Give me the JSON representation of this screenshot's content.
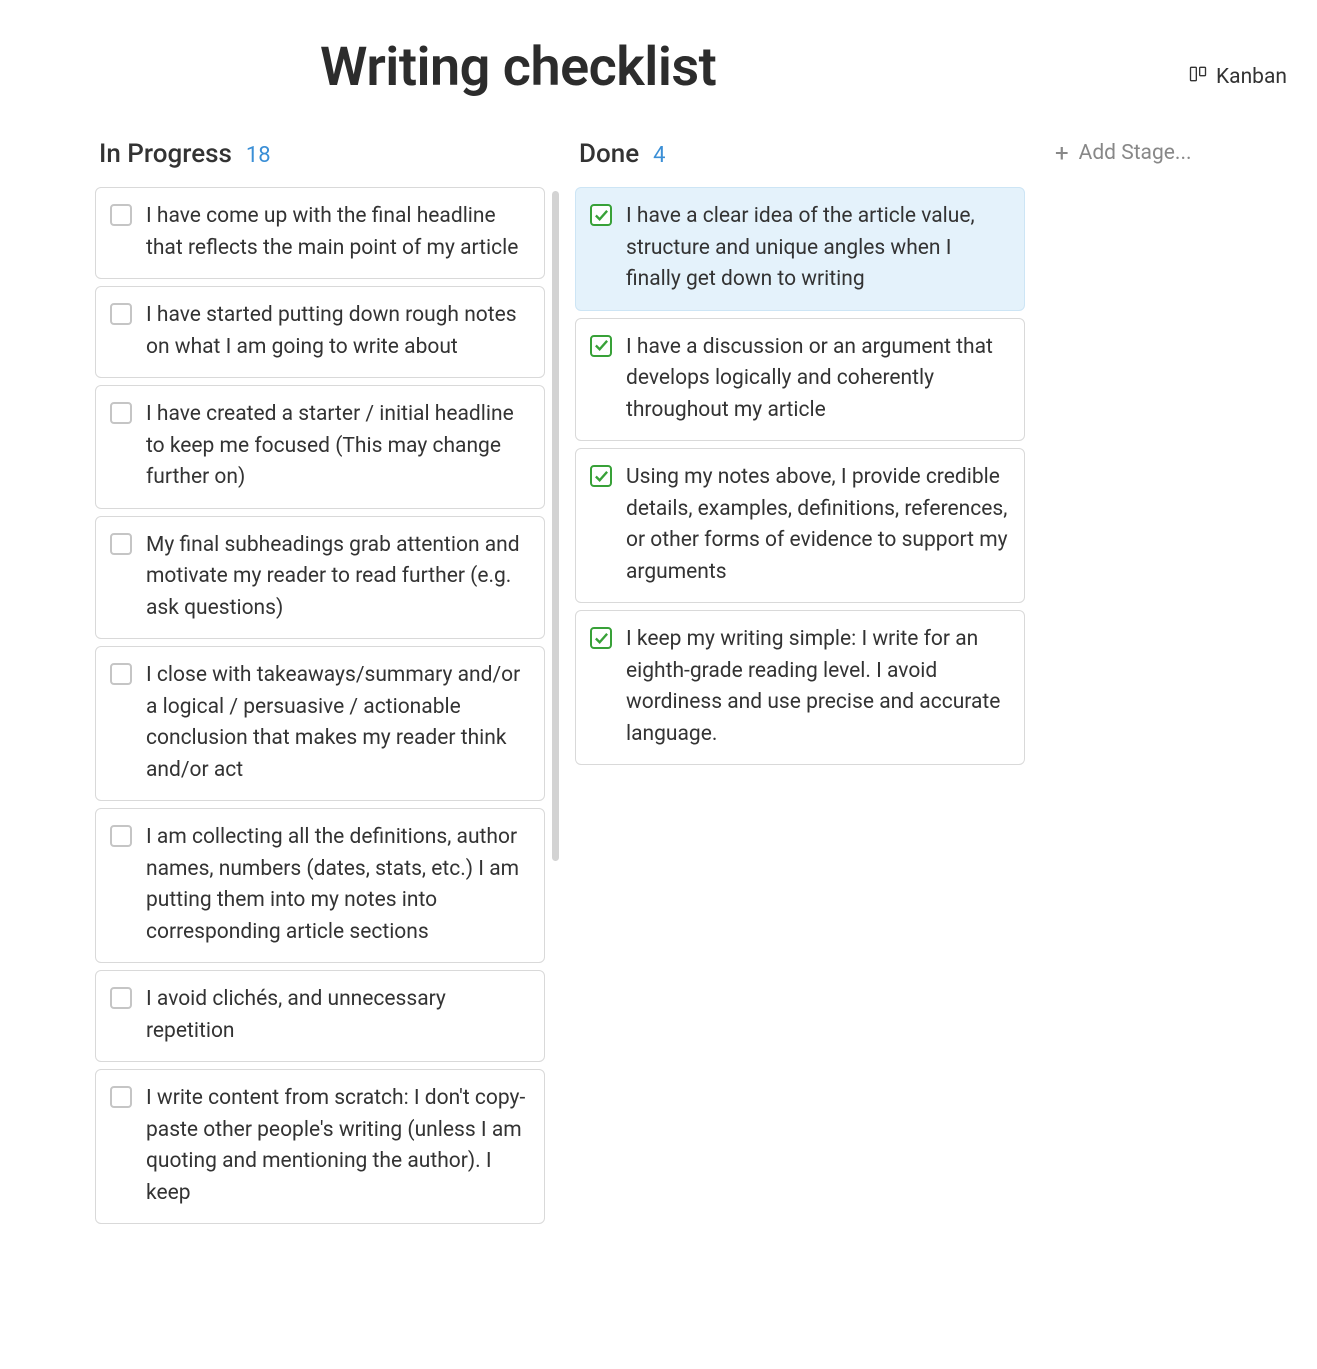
{
  "page_title": "Writing checklist",
  "view": {
    "label": "Kanban"
  },
  "add_stage_label": "Add Stage...",
  "columns": [
    {
      "title": "In Progress",
      "count": 18,
      "cards": [
        {
          "text": "I have come up with the final headline that reflects the main point of my article",
          "checked": false,
          "highlighted": false
        },
        {
          "text": "I have started putting down rough notes on what I am going to write about",
          "checked": false,
          "highlighted": false
        },
        {
          "text": "I have created a starter / initial headline to keep me focused (This may change further on)",
          "checked": false,
          "highlighted": false
        },
        {
          "text": "My final subheadings grab attention and motivate my reader to read further (e.g. ask questions)",
          "checked": false,
          "highlighted": false
        },
        {
          "text": "I close with takeaways/summary and/or a logical / persuasive / actionable conclusion that makes my reader think and/or act",
          "checked": false,
          "highlighted": false
        },
        {
          "text": "I am collecting all the definitions, author names, numbers (dates, stats, etc.) I am putting them into my notes into corresponding article sections",
          "checked": false,
          "highlighted": false
        },
        {
          "text": "I avoid clichés, and unnecessary repetition",
          "checked": false,
          "highlighted": false
        },
        {
          "text": "I write content from scratch: I don't copy-paste other people's writing (unless I am quoting and mentioning the author). I keep",
          "checked": false,
          "highlighted": false
        }
      ]
    },
    {
      "title": "Done",
      "count": 4,
      "cards": [
        {
          "text": "I have a clear idea of the article value, structure and unique angles when I finally get down to writing",
          "checked": true,
          "highlighted": true
        },
        {
          "text": "I have a discussion or an argument that develops logically and coherently throughout my article",
          "checked": true,
          "highlighted": false
        },
        {
          "text": "Using my notes above, I provide credible details, examples, definitions, references, or other forms of evidence to support my arguments",
          "checked": true,
          "highlighted": false
        },
        {
          "text": "I keep my writing simple: I write for an eighth-grade reading level. I avoid wordiness and use precise and accurate language.",
          "checked": true,
          "highlighted": false
        }
      ]
    }
  ]
}
